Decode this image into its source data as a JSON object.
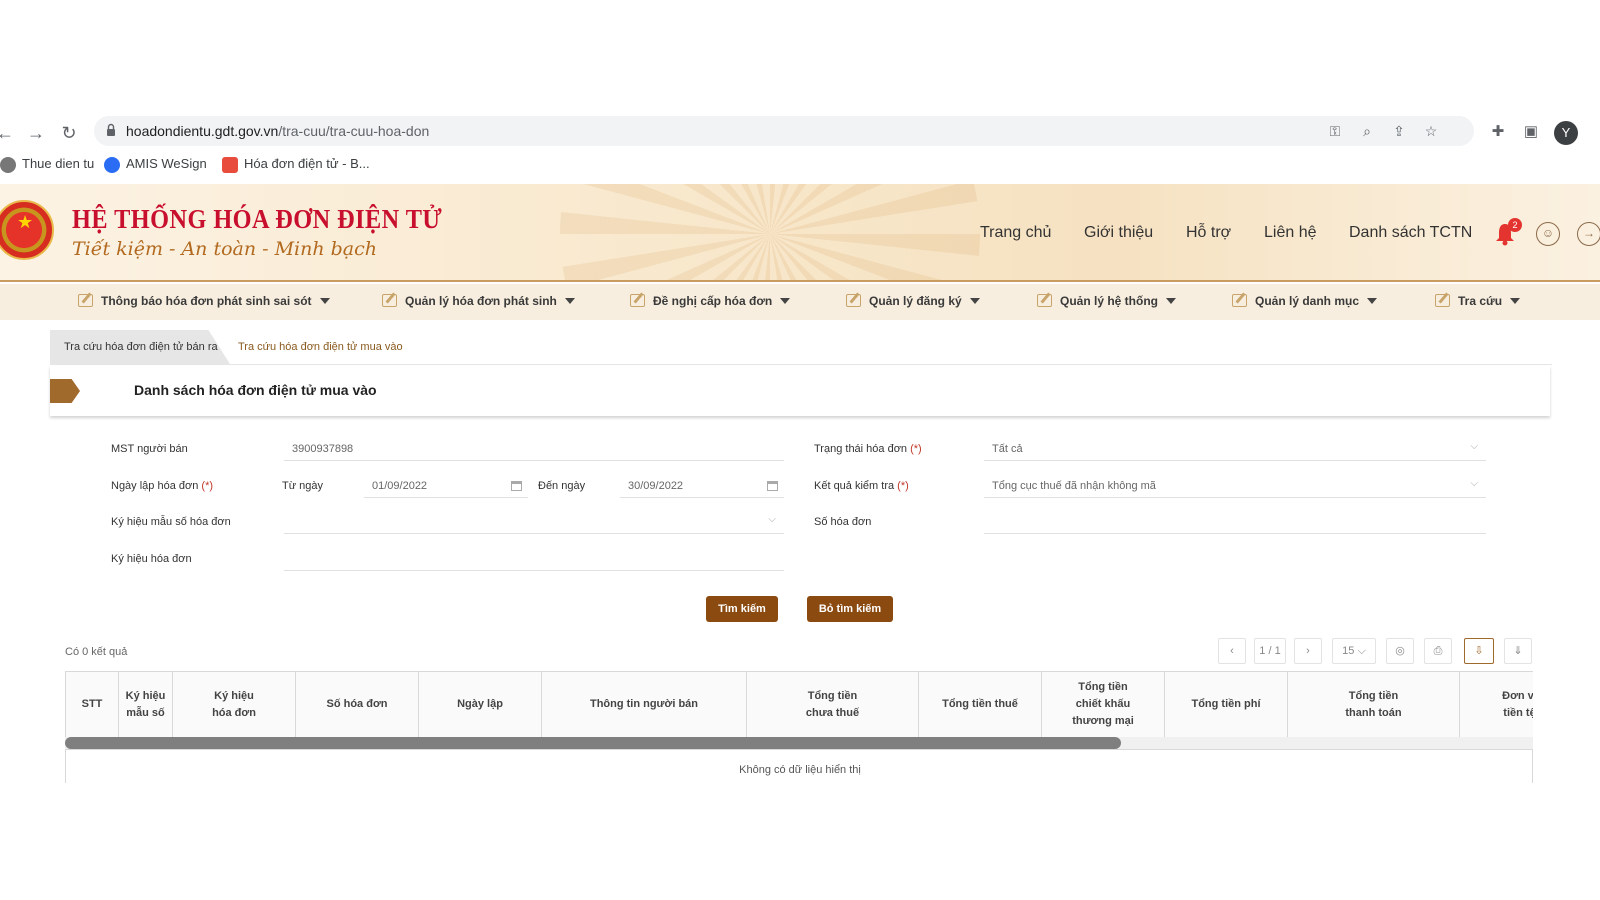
{
  "browser": {
    "url_host": "hoadondientu.gdt.gov.vn",
    "url_path": "/tra-cuu/tra-cuu-hoa-don",
    "profile_initial": "Y",
    "bookmarks": [
      "Thue dien tu",
      "AMIS WeSign",
      "Hóa đơn điện tử - B..."
    ]
  },
  "site": {
    "title": "HỆ THỐNG HÓA ĐƠN ĐIỆN TỬ",
    "slogan": "Tiết kiệm - An toàn - Minh bạch",
    "top_links": [
      "Trang chủ",
      "Giới thiệu",
      "Hỗ trợ",
      "Liên hệ",
      "Danh sách TCTN"
    ],
    "notification_count": "2"
  },
  "menu": [
    "Thông báo hóa đơn phát sinh sai sót",
    "Quản lý hóa đơn phát sinh",
    "Đề nghị cấp hóa đơn",
    "Quản lý đăng ký",
    "Quản lý hệ thống",
    "Quản lý danh mục",
    "Tra cứu"
  ],
  "tabs": {
    "active": "Tra cứu hóa đơn điện tử bán ra",
    "other": "Tra cứu hóa đơn điện tử mua vào"
  },
  "section_title": "Danh sách hóa đơn điện tử mua vào",
  "form": {
    "mst_label": "MST người bán",
    "mst_value": "3900937898",
    "ngay_lap_label": "Ngày lập hóa đơn",
    "tu_ngay_label": "Từ ngày",
    "tu_ngay_value": "01/09/2022",
    "den_ngay_label": "Đến ngày",
    "den_ngay_value": "30/09/2022",
    "ky_hieu_mau_label": "Ký hiệu mẫu số hóa đơn",
    "ky_hieu_label": "Ký hiệu hóa đơn",
    "trang_thai_label": "Trạng thái hóa đơn",
    "trang_thai_value": "Tất cả",
    "ket_qua_label": "Kết quả kiểm tra",
    "ket_qua_value": "Tổng cục thuế đã nhận không mã",
    "so_hoa_don_label": "Số hóa đơn",
    "required_mark": "(*)"
  },
  "buttons": {
    "search": "Tìm kiếm",
    "clear": "Bỏ tìm kiếm"
  },
  "results": {
    "count_text": "Có 0 kết quả",
    "page": "1 / 1",
    "page_size": "15",
    "empty_text": "Không có dữ liệu hiển thị"
  },
  "table": {
    "columns": [
      "STT",
      "Ký hiệu\nmẫu số",
      "Ký hiệu\nhóa đơn",
      "Số hóa đơn",
      "Ngày lập",
      "Thông tin người bán",
      "Tổng tiền\nchưa thuế",
      "Tổng tiền thuế",
      "Tổng tiền\nchiết khấu\nthương mại",
      "Tổng tiền phí",
      "Tổng tiền\nthanh toán",
      "Đơn vị\ntiền tệ"
    ]
  },
  "colors": {
    "brand": "#8b4a10",
    "title_red": "#c8102e",
    "header_bg": "#f8e7cb"
  }
}
